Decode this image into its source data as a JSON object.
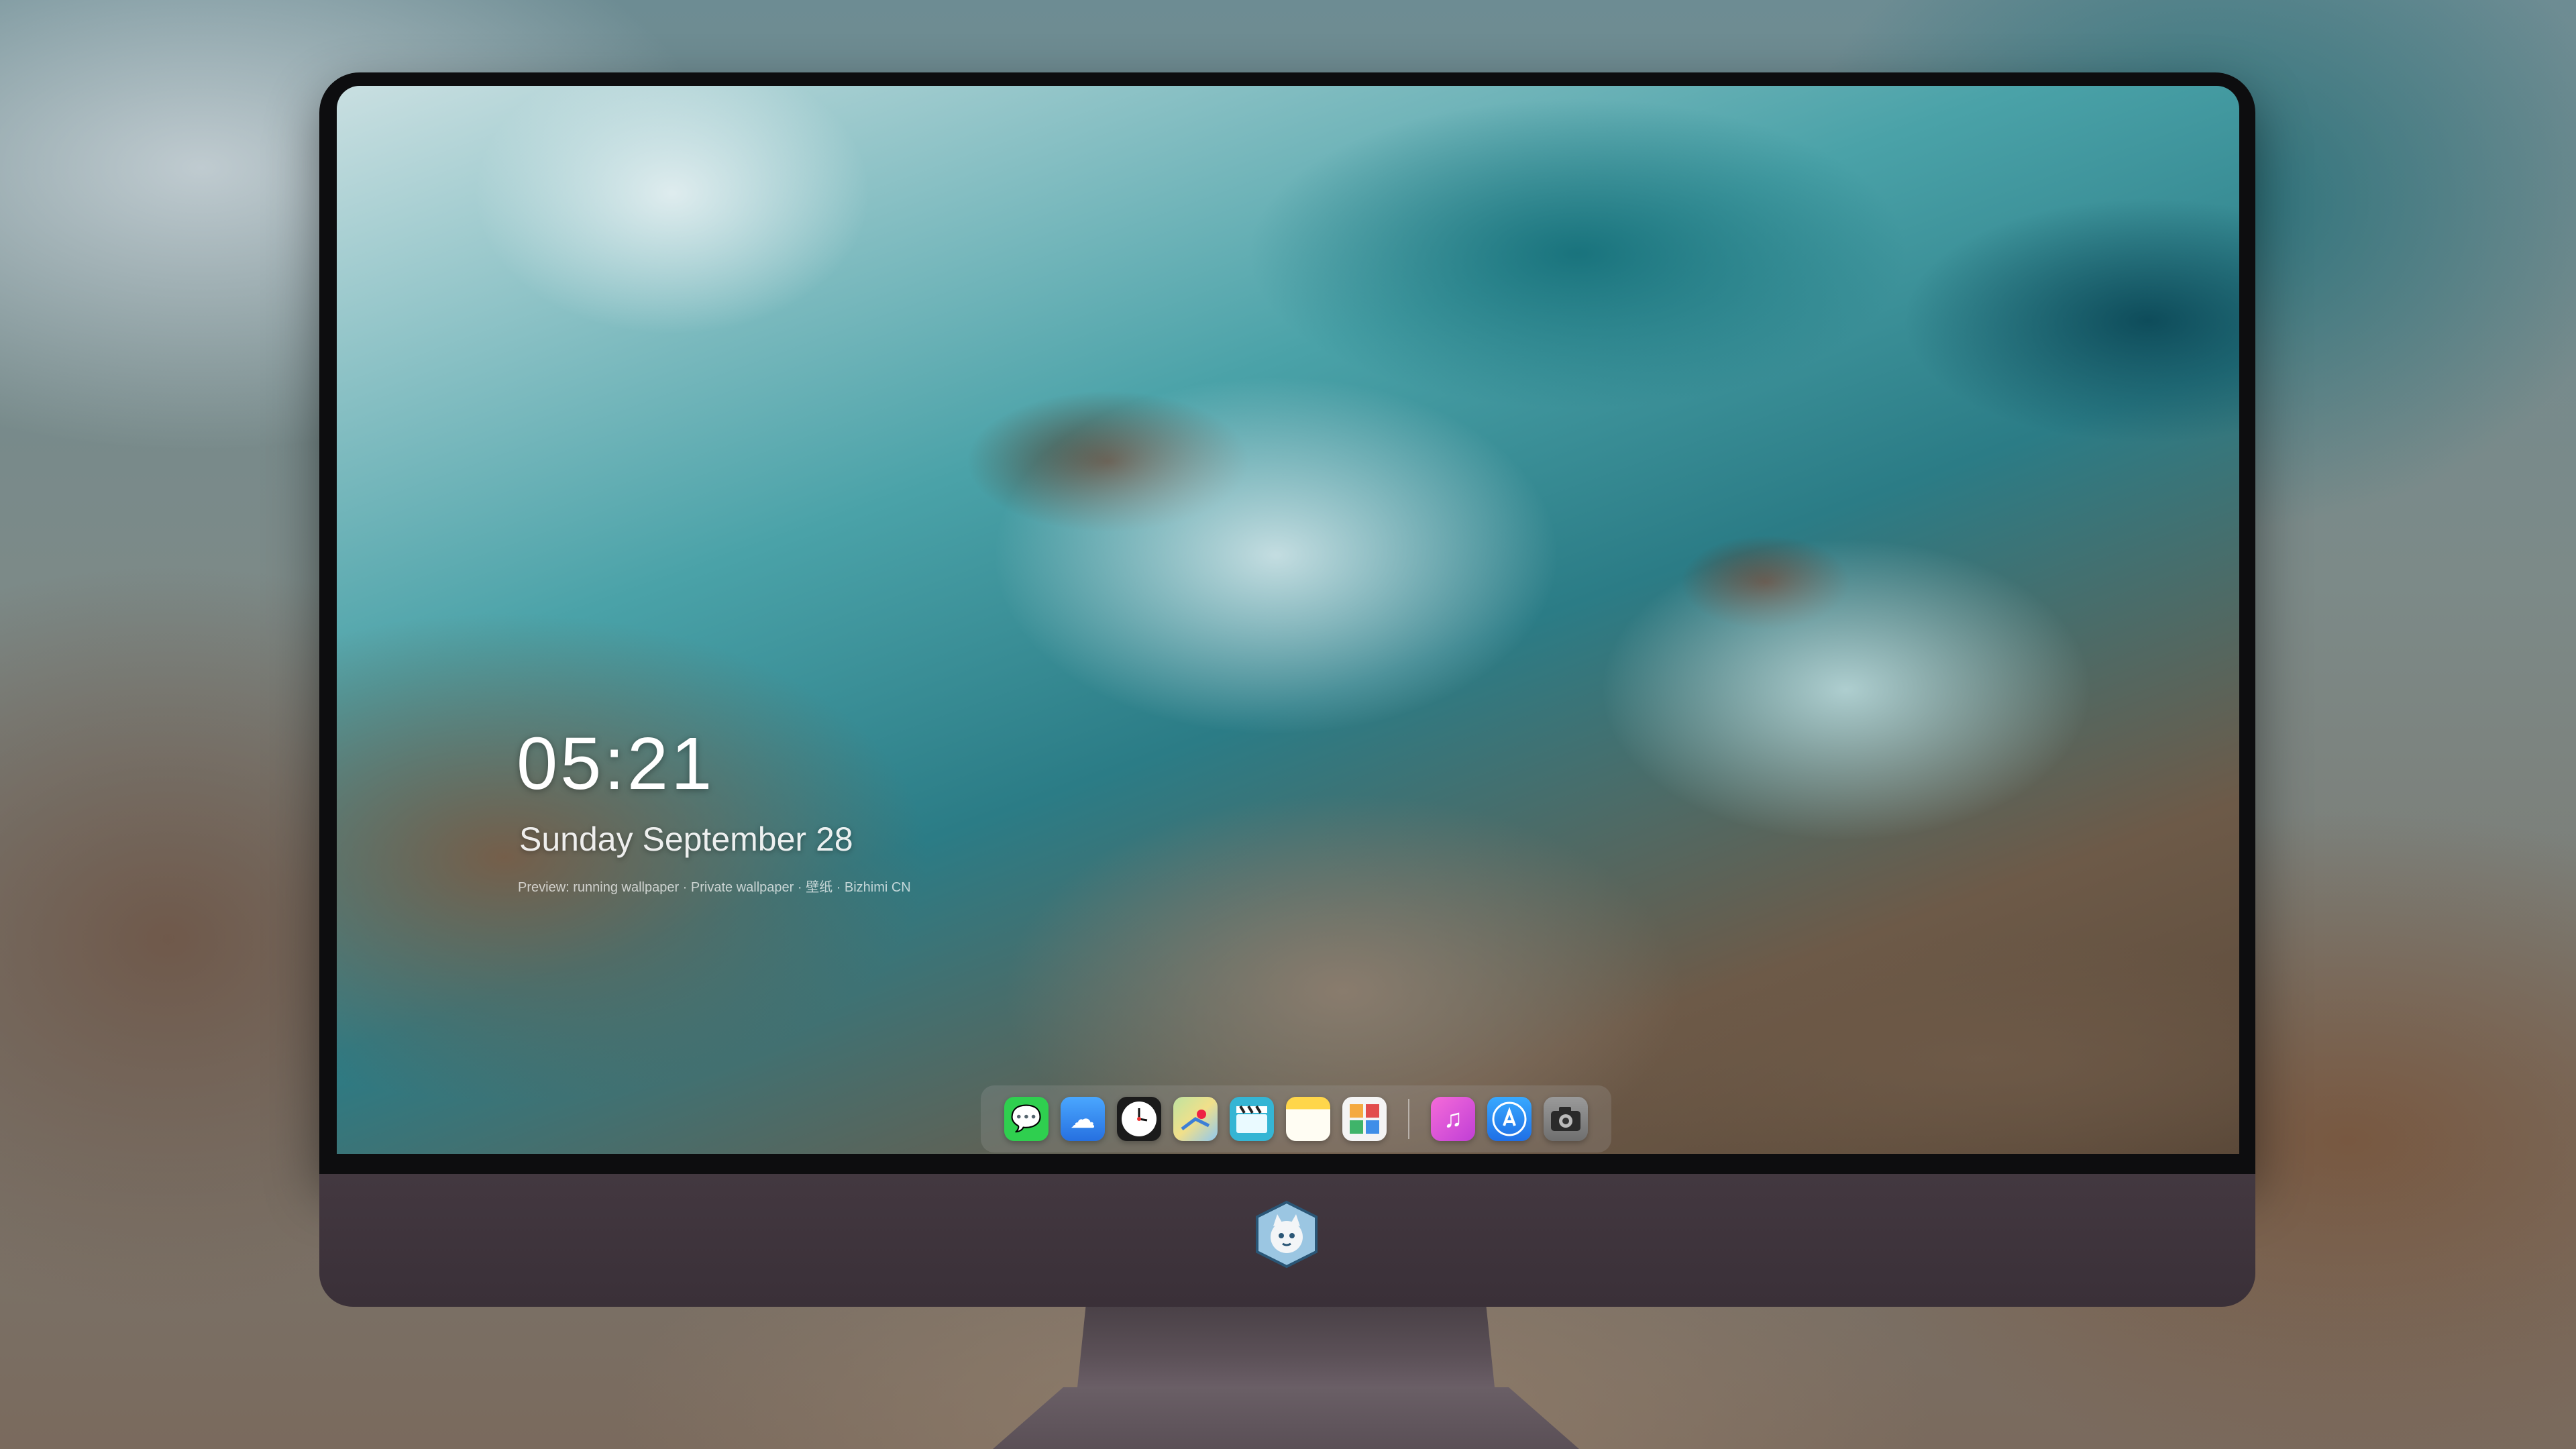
{
  "lock_screen": {
    "time": "05:21",
    "date": "Sunday September  28",
    "credit": "Preview: running wallpaper · Private wallpaper · 壁纸 · Bizhimi CN"
  },
  "dock": {
    "apps": [
      {
        "name": "Messages",
        "icon": "messages-icon",
        "glyph": "💬",
        "color": "#2fcf4f"
      },
      {
        "name": "Weather",
        "icon": "weather-icon",
        "glyph": "☁",
        "color": "#3a8ef0"
      },
      {
        "name": "Clock",
        "icon": "clock-icon",
        "glyph": "🕐",
        "color": "#f2f2f2"
      },
      {
        "name": "Maps",
        "icon": "maps-icon",
        "glyph": "⌖",
        "color": "#e9d27a"
      },
      {
        "name": "Clips",
        "icon": "clapperboard-icon",
        "glyph": "🎬",
        "color": "#3fb8d8"
      },
      {
        "name": "Notes",
        "icon": "notes-icon",
        "glyph": "▤",
        "color": "#ffd64a"
      },
      {
        "name": "Photos",
        "icon": "photos-icon",
        "glyph": "✿",
        "color": "#e9e9e9"
      },
      {
        "name": "Music",
        "icon": "music-icon",
        "glyph": "♫",
        "color": "#e64fd3"
      },
      {
        "name": "App Store",
        "icon": "app-store-icon",
        "glyph": "Ⓐ",
        "color": "#2f8af0"
      },
      {
        "name": "Camera",
        "icon": "camera-icon",
        "glyph": "📷",
        "color": "#8a8a8a"
      }
    ]
  },
  "colors": {
    "bezel": "#3a3038",
    "screen_border": "#0d0d0f"
  }
}
